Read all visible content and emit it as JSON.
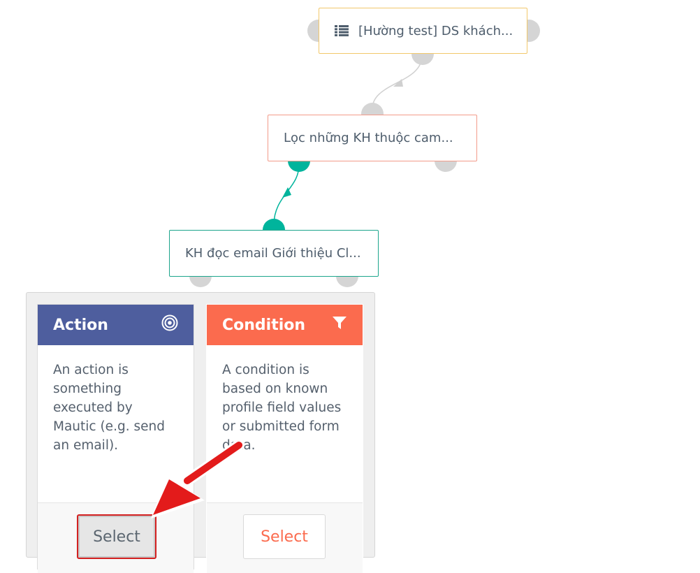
{
  "flow": {
    "source_node": {
      "label": "[Hường test] DS khách...",
      "icon": "list-icon"
    },
    "condition_node": {
      "label": "Lọc những KH thuộc cam..."
    },
    "decision_node": {
      "label": "KH đọc email Giới thiệu Cl..."
    }
  },
  "picker": {
    "action": {
      "title": "Action",
      "icon": "target-icon",
      "description": "An action is something executed by Mautic (e.g. send an email).",
      "button": "Select",
      "color": "#4e5e9e"
    },
    "condition": {
      "title": "Condition",
      "icon": "filter-icon",
      "description": "A condition is based on known profile field values or submitted form data.",
      "button": "Select",
      "color": "#fb6b4e"
    }
  },
  "colors": {
    "source_border": "#f2c86b",
    "condition_border": "#f39b8a",
    "decision_border": "#1ca58c",
    "yes_connector": "#00b49c",
    "annotation": "#e31b1b"
  }
}
